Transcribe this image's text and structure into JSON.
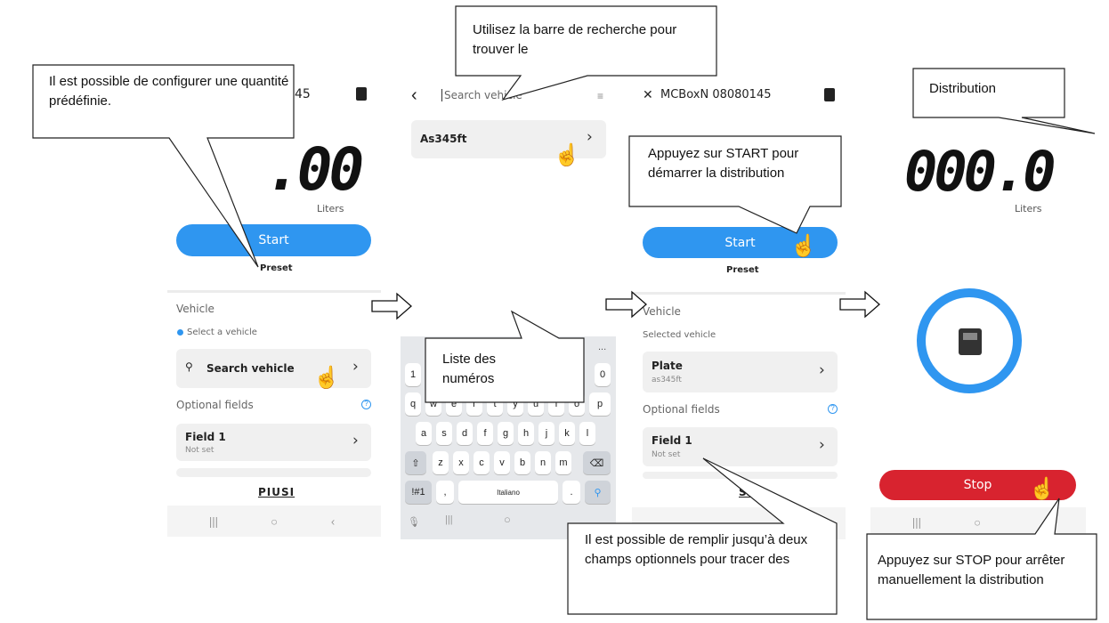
{
  "units": "Liters",
  "screen1": {
    "title_fragment": "45",
    "counter": ".00",
    "start": "Start",
    "preset": "Preset",
    "vehicle_header": "Vehicle",
    "select_vehicle": "Select a vehicle",
    "search_vehicle": "Search vehicle",
    "optional_fields": "Optional fields",
    "field1": "Field 1",
    "field1_value": "Not set",
    "logo": "PIUSI"
  },
  "screen2": {
    "search_placeholder": "Search vehicle",
    "result": "As345ft",
    "keyboard": {
      "row_top": [
        "1",
        "0"
      ],
      "row_top_more": "...",
      "row_q": [
        "q",
        "w",
        "e",
        "r",
        "t",
        "y",
        "u",
        "i",
        "o",
        "p"
      ],
      "row_a": [
        "a",
        "s",
        "d",
        "f",
        "g",
        "h",
        "j",
        "k",
        "l"
      ],
      "row_z": [
        "z",
        "x",
        "c",
        "v",
        "b",
        "n",
        "m"
      ],
      "symbols": "!#1",
      "comma": ",",
      "space": "Italiano",
      "period": "."
    }
  },
  "screen3": {
    "title": "MCBoxN 08080145",
    "start": "Start",
    "preset": "Preset",
    "vehicle_header": "Vehicle",
    "selected_vehicle": "Selected vehicle",
    "plate_label": "Plate",
    "plate_value": "as345ft",
    "optional_fields": "Optional fields",
    "field1": "Field 1",
    "field1_value": "Not set",
    "logo_fragment": "SI"
  },
  "screen4": {
    "counter": "000.0",
    "stop": "Stop"
  },
  "callouts": {
    "configure": "Il est possible de configurer une quantité prédéfinie.",
    "search": "Utilisez la barre de recherche pour trouver le",
    "list": "Liste des numéros",
    "start": "Appuyez sur START pour démarrer la distribution",
    "optional": "Il est possible de remplir jusqu’à deux champs optionnels pour tracer des",
    "distribution": "Distribution",
    "stop": "Appuyez sur STOP pour arrêter manuellement la distribution"
  },
  "colors": {
    "accent_blue": "#2f96f0",
    "stop_red": "#d8232f"
  }
}
